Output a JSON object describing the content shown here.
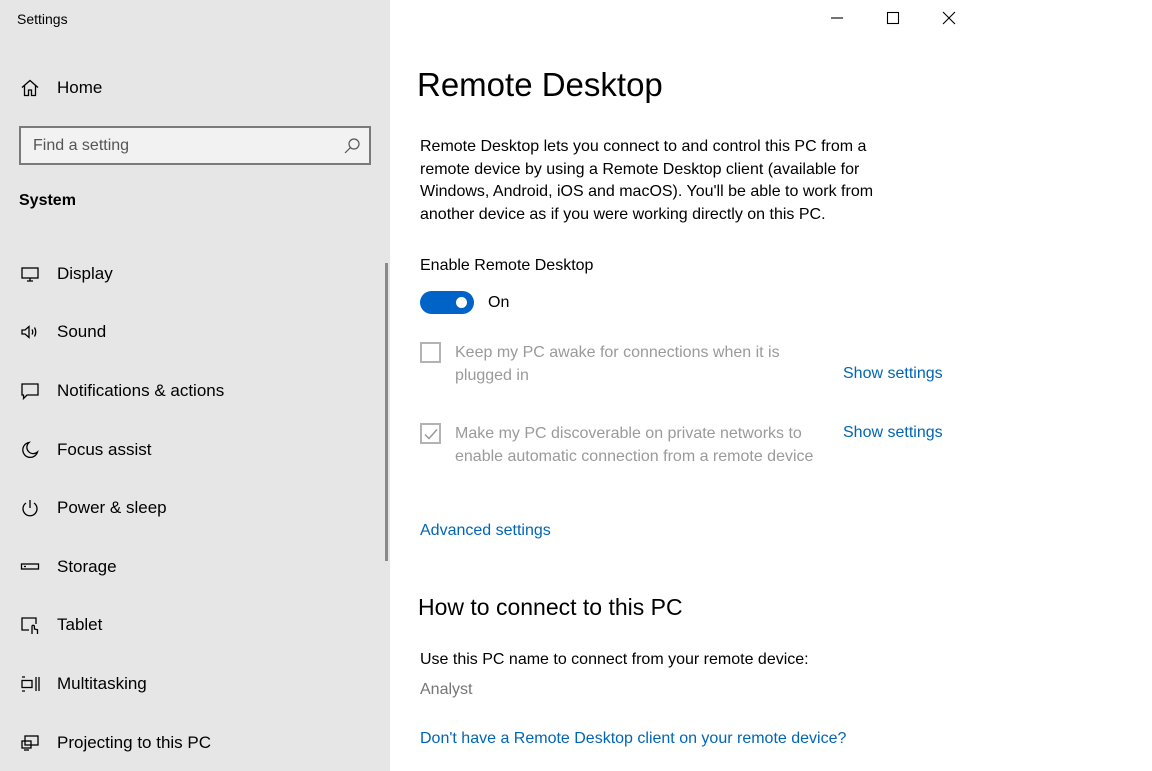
{
  "window": {
    "app_title": "Settings"
  },
  "sidebar": {
    "home_label": "Home",
    "search_placeholder": "Find a setting",
    "section_heading": "System",
    "items": [
      {
        "label": "Display",
        "icon": "display-icon"
      },
      {
        "label": "Sound",
        "icon": "sound-icon"
      },
      {
        "label": "Notifications & actions",
        "icon": "notifications-icon"
      },
      {
        "label": "Focus assist",
        "icon": "moon-icon"
      },
      {
        "label": "Power & sleep",
        "icon": "power-icon"
      },
      {
        "label": "Storage",
        "icon": "storage-icon"
      },
      {
        "label": "Tablet",
        "icon": "tablet-icon"
      },
      {
        "label": "Multitasking",
        "icon": "multitasking-icon"
      },
      {
        "label": "Projecting to this PC",
        "icon": "projecting-icon"
      }
    ]
  },
  "main": {
    "title": "Remote Desktop",
    "description": "Remote Desktop lets you connect to and control this PC from a remote device by using a Remote Desktop client (available for Windows, Android, iOS and macOS). You'll be able to work from another device as if you were working directly on this PC.",
    "enable_label": "Enable Remote Desktop",
    "toggle_state": "On",
    "toggle_on": true,
    "option_awake": {
      "label": "Keep my PC awake for connections when it is plugged in",
      "checked": false,
      "link": "Show settings"
    },
    "option_discoverable": {
      "label": "Make my PC discoverable on private networks to enable automatic connection from a remote device",
      "checked": true,
      "link": "Show settings"
    },
    "advanced_link": "Advanced settings",
    "section2_title": "How to connect to this PC",
    "pc_name_label": "Use this PC name to connect from your remote device:",
    "pc_name": "Analyst",
    "client_link": "Don't have a Remote Desktop client on your remote device?"
  },
  "colors": {
    "accent": "#0063c7",
    "link": "#0066b4",
    "sidebar_bg": "#e6e6e6",
    "disabled_text": "#9a9a9a"
  }
}
